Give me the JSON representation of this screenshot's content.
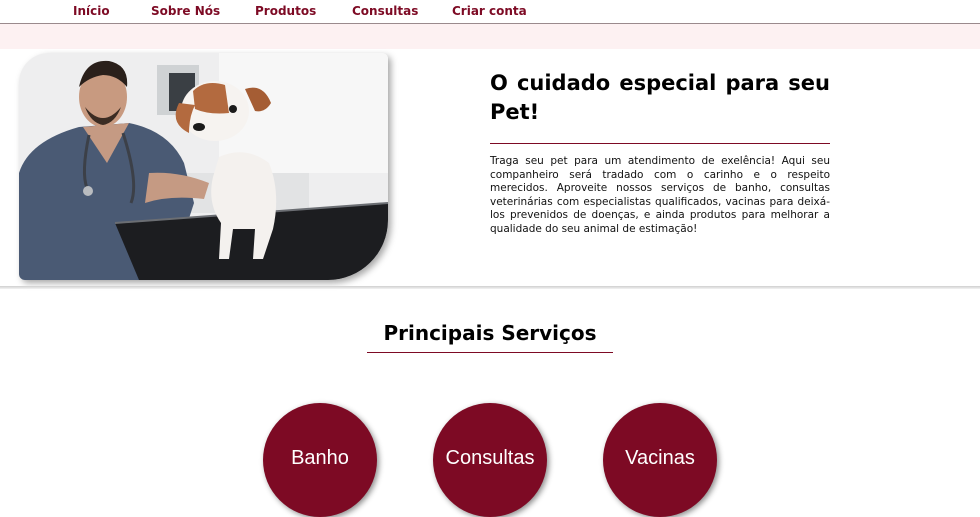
{
  "nav": {
    "items": [
      {
        "label": "Início"
      },
      {
        "label": "Sobre Nós"
      },
      {
        "label": "Produtos"
      },
      {
        "label": "Consultas"
      },
      {
        "label": "Criar conta"
      }
    ]
  },
  "hero": {
    "title": "O cuidado especial para seu Pet!",
    "text": "Traga seu pet para um atendimento de exelência! Aqui seu companheiro será tradado com o carinho e o respeito merecidos. Aproveite nossos serviços de banho, consultas veterinárias com especialistas qualificados, vacinas para deixá-los prevenidos de doenças, e ainda produtos para melhorar a qualidade do seu animal de estimação!"
  },
  "services": {
    "title": "Principais Serviços",
    "items": [
      {
        "label": "Banho"
      },
      {
        "label": "Consultas"
      },
      {
        "label": "Vacinas"
      }
    ]
  },
  "colors": {
    "accent": "#7d0a24",
    "band": "#fdf1f2"
  }
}
